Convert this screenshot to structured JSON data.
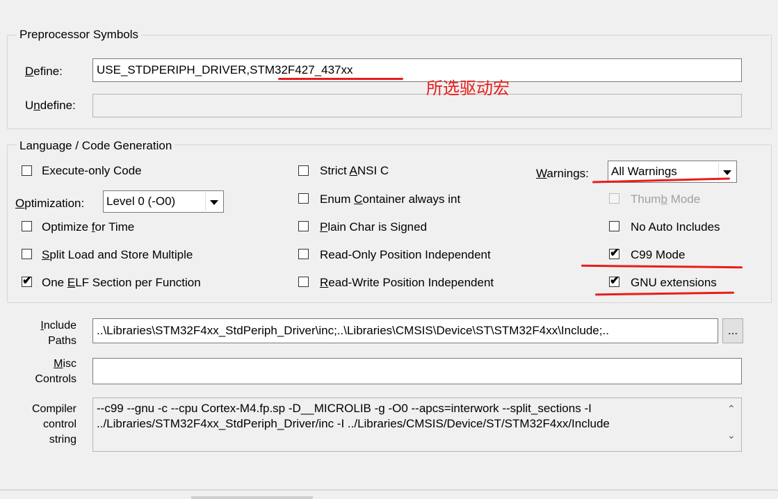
{
  "preprocessor": {
    "title": "Preprocessor Symbols",
    "define_label": "Define:",
    "define_value": "USE_STDPERIPH_DRIVER,STM32F427_437xx",
    "undefine_label": "Undefine:",
    "undefine_value": "",
    "annotation": "所选驱动宏"
  },
  "language": {
    "title": "Language / Code Generation",
    "execute_only": "Execute-only Code",
    "optimization_label": "Optimization:",
    "optimization_value": "Level 0 (-O0)",
    "optimize_time": "Optimize for Time",
    "split_load": "Split Load and Store Multiple",
    "one_elf": "One ELF Section per Function",
    "strict_ansi": "Strict ANSI C",
    "enum_container": "Enum Container always int",
    "plain_char": "Plain Char is Signed",
    "ro_pi": "Read-Only Position Independent",
    "rw_pi": "Read-Write Position Independent",
    "warnings_label": "Warnings:",
    "warnings_value": "All Warnings",
    "thumb_mode": "Thumb Mode",
    "no_auto_includes": "No Auto Includes",
    "c99_mode": "C99 Mode",
    "gnu_ext": "GNU extensions",
    "checks": {
      "execute_only": false,
      "optimize_time": false,
      "split_load": false,
      "one_elf": true,
      "strict_ansi": false,
      "enum_container": false,
      "plain_char": false,
      "ro_pi": false,
      "rw_pi": false,
      "thumb_mode": false,
      "no_auto_includes": false,
      "c99_mode": true,
      "gnu_ext": true
    }
  },
  "paths": {
    "include_label_1": "Include",
    "include_label_2": "Paths",
    "include_value": "..\\Libraries\\STM32F4xx_StdPeriph_Driver\\inc;..\\Libraries\\CMSIS\\Device\\ST\\STM32F4xx\\Include;..",
    "browse_label": "...",
    "misc_label_1": "Misc",
    "misc_label_2": "Controls",
    "misc_value": "",
    "compiler_label_1": "Compiler",
    "compiler_label_2": "control",
    "compiler_label_3": "string",
    "compiler_line_1": "--c99 --gnu -c --cpu Cortex-M4.fp.sp -D__MICROLIB -g -O0 --apcs=interwork --split_sections -I",
    "compiler_line_2": "../Libraries/STM32F4xx_StdPeriph_Driver/inc -I ../Libraries/CMSIS/Device/ST/STM32F4xx/Include"
  },
  "colors": {
    "annotation": "#e81c1c",
    "background": "#f0f0f0"
  },
  "icons": {
    "checkmark": "check-icon",
    "dropdown": "chevron-down-icon",
    "scroll_up": "scroll-up-icon",
    "scroll_down": "scroll-down-icon"
  }
}
